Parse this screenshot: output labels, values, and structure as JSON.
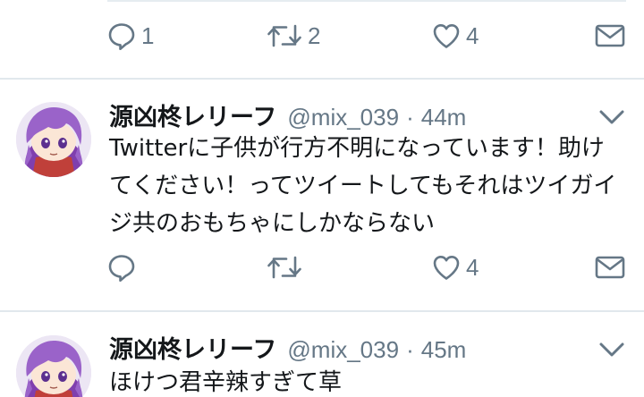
{
  "previous_tweet": {
    "reply_count": "1",
    "retweet_count": "2",
    "like_count": "4"
  },
  "tweets": [
    {
      "display_name": "源凶柊レリーフ",
      "handle": "@mix_039",
      "separator": "·",
      "time": "44m",
      "text": "Twitterに子供が行方不明になっています！助けてください！ってツイートしてもそれはツイガイジ共のおもちゃにしかならない",
      "reply_count": "",
      "retweet_count": "",
      "like_count": "4"
    },
    {
      "display_name": "源凶柊レリーフ",
      "handle": "@mix_039",
      "separator": "·",
      "time": "45m",
      "text": "ほけつ君辛辣すぎて草"
    }
  ],
  "icons": {
    "reply": "reply-icon",
    "retweet": "retweet-icon",
    "like": "heart-icon",
    "dm": "envelope-icon",
    "menu": "chevron-down-icon"
  },
  "colors": {
    "text": "#14171a",
    "secondary": "#657786",
    "divider": "#e1e8ed"
  }
}
